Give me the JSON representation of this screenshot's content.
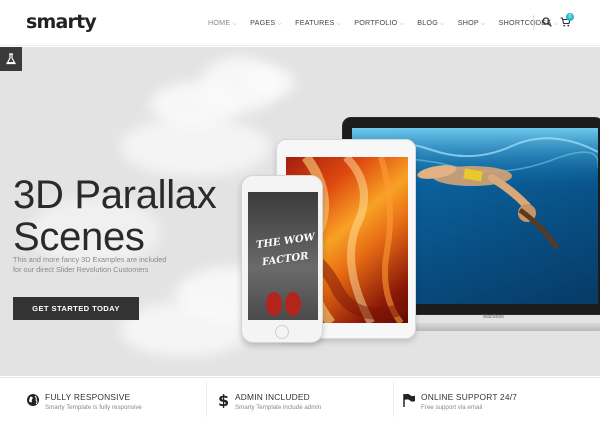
{
  "brand": {
    "logo": "smarty"
  },
  "nav": {
    "items": [
      {
        "label": "HOME",
        "active": true
      },
      {
        "label": "PAGES"
      },
      {
        "label": "FEATURES"
      },
      {
        "label": "PORTFOLIO"
      },
      {
        "label": "BLOG"
      },
      {
        "label": "SHOP"
      },
      {
        "label": "SHORTCODES"
      }
    ],
    "caret": "⌵",
    "cart_count": "0",
    "icons": [
      "search-icon",
      "cart-icon"
    ]
  },
  "hero": {
    "title_line1": "3D Parallax",
    "title_line2": "Scenes",
    "subtitle_line1": "This and more fancy 3D Examples are included",
    "subtitle_line2": "for our direct Slider Revolution Customers",
    "cta_label": "GET STARTED TODAY",
    "side_tab_icon": "flask-icon",
    "phone_text_1": "THE WOW",
    "phone_text_2": "FACTOR",
    "laptop_brand": "MacBook"
  },
  "features": [
    {
      "icon": "globe-icon",
      "title": "FULLY RESPONSIVE",
      "desc": "Smarty Template is fully responsive"
    },
    {
      "icon": "dollar-icon",
      "title": "ADMIN INCLUDED",
      "desc": "Smarty Template include admin"
    },
    {
      "icon": "flag-icon",
      "title": "ONLINE SUPPORT 24/7",
      "desc": "Free support via email"
    }
  ],
  "colors": {
    "accent": "#29b6d0",
    "cta_bg": "#333333",
    "hero_bg": "#e3e3e3"
  }
}
